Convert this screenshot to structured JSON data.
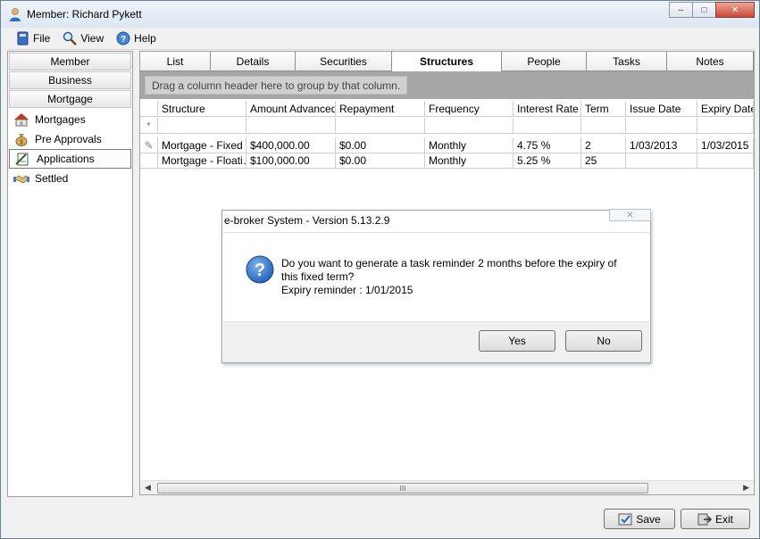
{
  "window": {
    "title": "Member: Richard Pykett",
    "controls": {
      "minimize": "–",
      "maximize": "□",
      "close": "✕"
    }
  },
  "menu": [
    {
      "label": "File",
      "icon": "file-icon"
    },
    {
      "label": "View",
      "icon": "view-icon"
    },
    {
      "label": "Help",
      "icon": "help-icon"
    }
  ],
  "sidebar": {
    "sections": [
      "Member",
      "Business",
      "Mortgage"
    ],
    "items": [
      {
        "label": "Mortgages",
        "icon": "house-icon"
      },
      {
        "label": "Pre Approvals",
        "icon": "money-bag-icon"
      },
      {
        "label": "Applications",
        "icon": "application-icon",
        "selected": true
      },
      {
        "label": "Settled",
        "icon": "handshake-icon"
      }
    ]
  },
  "tabs": [
    "List",
    "Details",
    "Securities",
    "Structures",
    "People",
    "Tasks",
    "Notes"
  ],
  "active_tab": "Structures",
  "group_hint": "Drag a column header here to group by that column.",
  "grid": {
    "new_row_marker": "*",
    "edit_marker": "✎",
    "columns": [
      "Structure",
      "Amount Advanced",
      "Repayment",
      "Frequency",
      "Interest Rate",
      "Term",
      "Issue Date",
      "Expiry Date"
    ],
    "rows": [
      [
        "Mortgage - Fixed",
        "$400,000.00",
        "$0.00",
        "Monthly",
        "4.75 %",
        "2",
        "1/03/2013",
        "1/03/2015"
      ],
      [
        "Mortgage - Floati…",
        "$100,000.00",
        "$0.00",
        "Monthly",
        "5.25 %",
        "25",
        "",
        ""
      ]
    ]
  },
  "scrollbar": {
    "left": "◀",
    "right": "▶",
    "grip": "III"
  },
  "buttons": {
    "save": "Save",
    "exit": "Exit"
  },
  "dialog": {
    "title": "e-broker System - Version 5.13.2.9",
    "close": "✕",
    "message_line1": "Do you want to generate a task reminder 2 months before the expiry of",
    "message_line2": "this fixed term?",
    "message_line3": "Expiry reminder : 1/01/2015",
    "yes": "Yes",
    "no": "No"
  },
  "colors": {
    "group_area": "#a6a6a6",
    "question_icon": "#1f5fb8"
  }
}
